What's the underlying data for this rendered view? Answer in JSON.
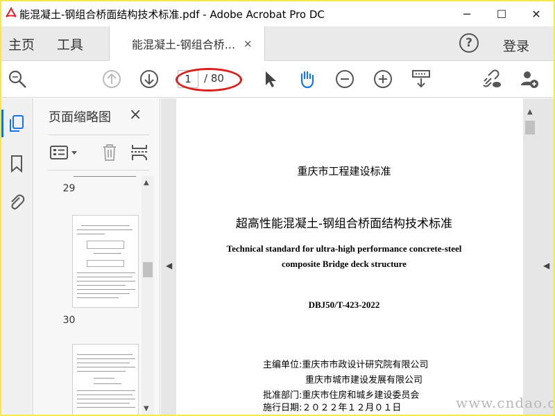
{
  "window": {
    "title": "能混凝土-钢组合桥面结构技术标准.pdf - Adobe Acrobat Pro DC",
    "minimize": "─",
    "maximize": "☐",
    "close": "✕"
  },
  "menu": {
    "home": "主页",
    "tools": "工具",
    "doc_tab": "能混凝土-钢组合桥...",
    "doc_tab_close": "×",
    "help": "?",
    "login": "登录"
  },
  "toolbar": {
    "page_current": "1",
    "page_total": "/ 80"
  },
  "thumbnails": {
    "title": "页面缩略图",
    "close": "×",
    "pages": [
      {
        "number": "29"
      },
      {
        "number": "30"
      }
    ]
  },
  "document": {
    "standard_type": "重庆市工程建设标准",
    "title_cn": "超高性能混凝土-钢组合桥面结构技术标准",
    "title_en_line1": "Technical standard for ultra-high performance concrete-steel",
    "title_en_line2": "composite Bridge deck structure",
    "code": "DBJ50/T-423-2022",
    "meta": [
      "主编单位:重庆市市政设计研究院有限公司",
      "重庆市城市建设发展有限公司",
      "批准部门:重庆市住房和城乡建设委员会",
      "施行日期:２０２２年１２月０１日"
    ]
  },
  "watermark": "www.cndao.com",
  "colors": {
    "accent": "#1473e6",
    "highlight": "#d8201c",
    "frame": "#f5e84a"
  }
}
